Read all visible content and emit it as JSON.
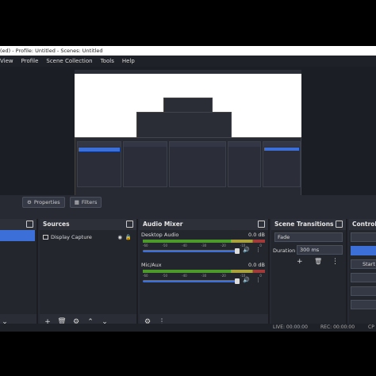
{
  "window": {
    "title": "(ed) - Profile: Untitled - Scenes: Untitled"
  },
  "menu": [
    "View",
    "Profile",
    "Scene Collection",
    "Tools",
    "Help"
  ],
  "toolbar": {
    "properties_label": "Properties",
    "filters_label": "Filters"
  },
  "docks": {
    "sources": {
      "title": "Sources",
      "items": [
        "Display Capture"
      ]
    },
    "audio_mixer": {
      "title": "Audio Mixer",
      "channels": [
        {
          "name": "Desktop Audio",
          "db": "0.0 dB",
          "volume": 0.95
        },
        {
          "name": "Mic/Aux",
          "db": "0.0 dB",
          "volume": 0.95
        }
      ],
      "scale": [
        "-60",
        "-55",
        "-50",
        "-45",
        "-40",
        "-35",
        "-30",
        "-25",
        "-20",
        "-15",
        "-10",
        "-5",
        "0"
      ]
    },
    "scene_transitions": {
      "title": "Scene Transitions",
      "transition": "Fade",
      "duration_label": "Duration",
      "duration_value": "300 ms"
    },
    "controls": {
      "title": "Controls",
      "start_label": "Start Re"
    }
  },
  "status": {
    "live": "LIVE: 00:00:00",
    "rec": "REC: 00:00:00",
    "cpu": "CP"
  },
  "colors": {
    "accent": "#3d6fd8",
    "meter_green": "#4c9a2a",
    "meter_yellow": "#a9a23a",
    "meter_red": "#a33a3a"
  }
}
